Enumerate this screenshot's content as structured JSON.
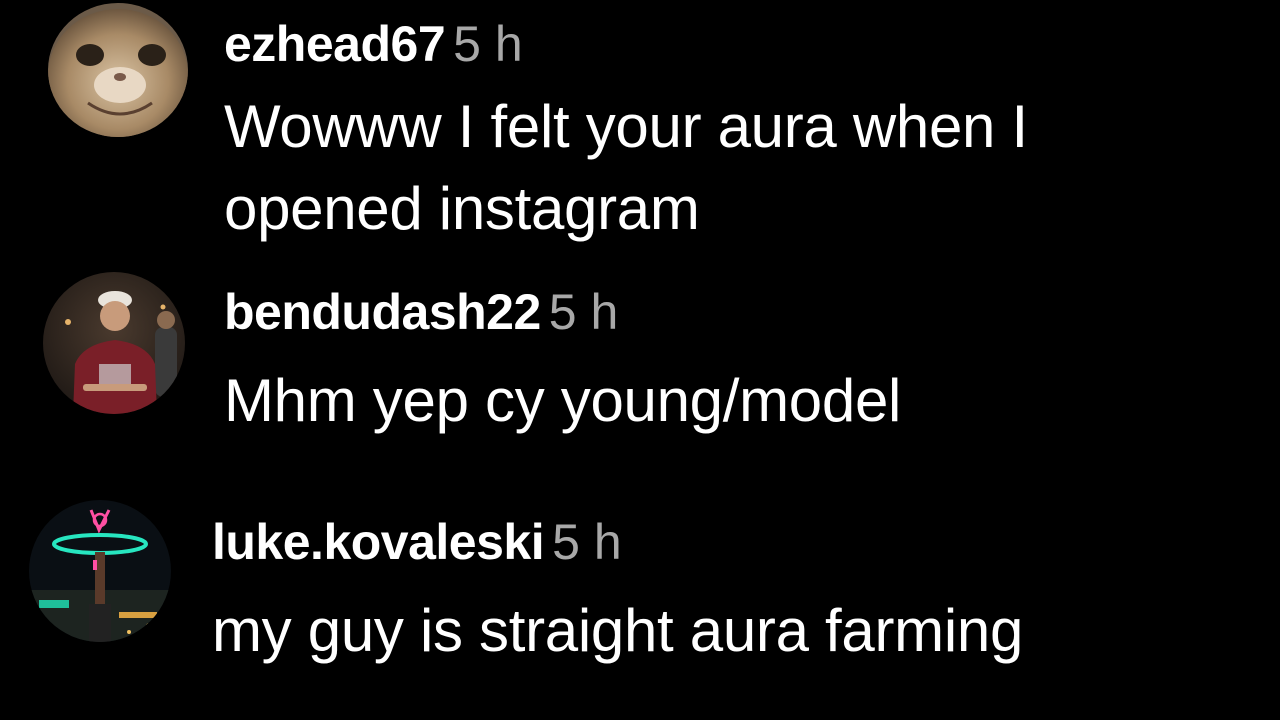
{
  "comments": [
    {
      "username": "ezhead67",
      "time": "5 h",
      "text": "Wowww I felt your aura when I opened instagram"
    },
    {
      "username": "bendudash22",
      "time": "5 h",
      "text": "Mhm yep cy young/model"
    },
    {
      "username": "luke.kovaleski",
      "time": "5 h",
      "text": "my guy is straight aura farming"
    }
  ],
  "colors": {
    "background": "#000000",
    "username": "#ffffff",
    "timestamp": "#a8a8a8",
    "text": "#ffffff"
  }
}
